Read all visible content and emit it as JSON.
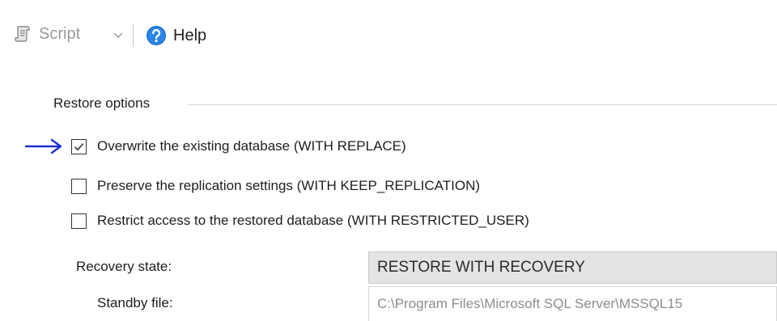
{
  "toolbar": {
    "script_label": "Script",
    "script_icon": "script-icon",
    "caret_icon": "chevron-down-icon",
    "help_label": "Help",
    "help_icon": "help-icon"
  },
  "restore_options": {
    "title": "Restore options",
    "checkboxes": [
      {
        "label": "Overwrite the existing database (WITH REPLACE)",
        "checked": true
      },
      {
        "label": "Preserve the replication settings (WITH KEEP_REPLICATION)",
        "checked": false
      },
      {
        "label": "Restrict access to the restored database (WITH RESTRICTED_USER)",
        "checked": false
      }
    ]
  },
  "recovery": {
    "state_label": "Recovery state:",
    "state_value": "RESTORE WITH RECOVERY",
    "standby_label": "Standby file:",
    "standby_value": "C:\\Program Files\\Microsoft SQL Server\\MSSQL15"
  },
  "annotation": {
    "arrow_color": "#1f2fd0"
  },
  "colors": {
    "help_icon_blue": "#1f6fd1",
    "dropdown_bg": "#e4e4e4",
    "disabled_text": "#8d8d8d"
  }
}
